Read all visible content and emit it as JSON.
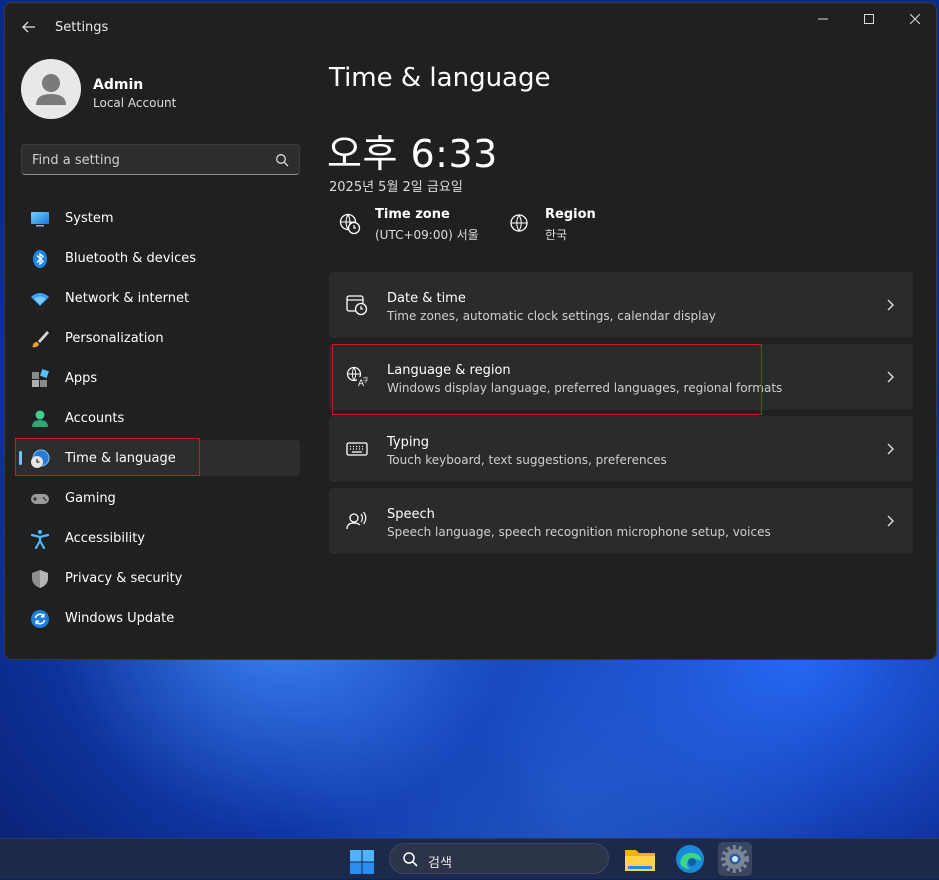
{
  "app": {
    "title": "Settings"
  },
  "window_controls": {
    "minimize_glyph": "—",
    "maximize_glyph": "☐",
    "close_glyph": "✕"
  },
  "profile": {
    "name": "Admin",
    "account_type": "Local Account"
  },
  "search": {
    "placeholder": "Find a setting"
  },
  "nav": {
    "items": [
      {
        "label": "System",
        "icon": "system-icon"
      },
      {
        "label": "Bluetooth & devices",
        "icon": "bluetooth-icon"
      },
      {
        "label": "Network & internet",
        "icon": "wifi-icon"
      },
      {
        "label": "Personalization",
        "icon": "brush-icon"
      },
      {
        "label": "Apps",
        "icon": "apps-icon"
      },
      {
        "label": "Accounts",
        "icon": "accounts-icon"
      },
      {
        "label": "Time & language",
        "icon": "time-language-icon",
        "selected": true
      },
      {
        "label": "Gaming",
        "icon": "gaming-icon"
      },
      {
        "label": "Accessibility",
        "icon": "accessibility-icon"
      },
      {
        "label": "Privacy & security",
        "icon": "shield-icon"
      },
      {
        "label": "Windows Update",
        "icon": "update-icon"
      }
    ]
  },
  "main": {
    "title": "Time & language",
    "clock": "오후 6:33",
    "date": "2025년 5월 2일 금요일",
    "timezone": {
      "title": "Time zone",
      "value": "(UTC+09:00) 서울"
    },
    "region": {
      "title": "Region",
      "value": "한국"
    },
    "cards": [
      {
        "title": "Date & time",
        "subtitle": "Time zones, automatic clock settings, calendar display",
        "icon": "calendar-clock-icon"
      },
      {
        "title": "Language & region",
        "subtitle": "Windows display language, preferred languages, regional formats",
        "icon": "language-icon"
      },
      {
        "title": "Typing",
        "subtitle": "Touch keyboard, text suggestions, preferences",
        "icon": "keyboard-icon"
      },
      {
        "title": "Speech",
        "subtitle": "Speech language, speech recognition microphone setup, voices",
        "icon": "speech-icon"
      }
    ]
  },
  "taskbar": {
    "search_label": "검색"
  },
  "colors": {
    "accent": "#60cdff",
    "highlight_box": "#d21818",
    "window_bg": "#202020",
    "card_bg": "#2b2b2b"
  }
}
